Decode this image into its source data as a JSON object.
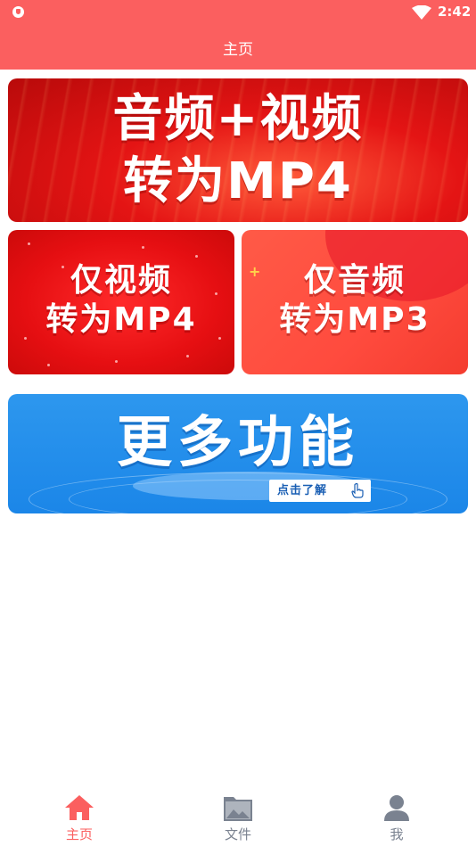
{
  "status_bar": {
    "time": "2:42"
  },
  "header": {
    "title": "主页"
  },
  "banners": {
    "audio_video_to_mp4": {
      "line1": "音频+视频",
      "line2": "转为MP4"
    },
    "video_to_mp4": {
      "line1": "仅视频",
      "line2": "转为MP4"
    },
    "audio_to_mp3": {
      "line1": "仅音频",
      "line2": "转为MP3"
    },
    "more_features": {
      "title": "更多功能",
      "cta": "点击了解"
    }
  },
  "bottom_nav": {
    "items": [
      {
        "label": "主页",
        "icon": "home-icon",
        "active": true
      },
      {
        "label": "文件",
        "icon": "image-folder-icon",
        "active": false
      },
      {
        "label": "我",
        "icon": "user-icon",
        "active": false
      }
    ]
  },
  "colors": {
    "accent": "#fb5f5f",
    "banner_red": "#e41414",
    "banner_blue": "#1b86e8",
    "nav_inactive": "#7a8290"
  }
}
